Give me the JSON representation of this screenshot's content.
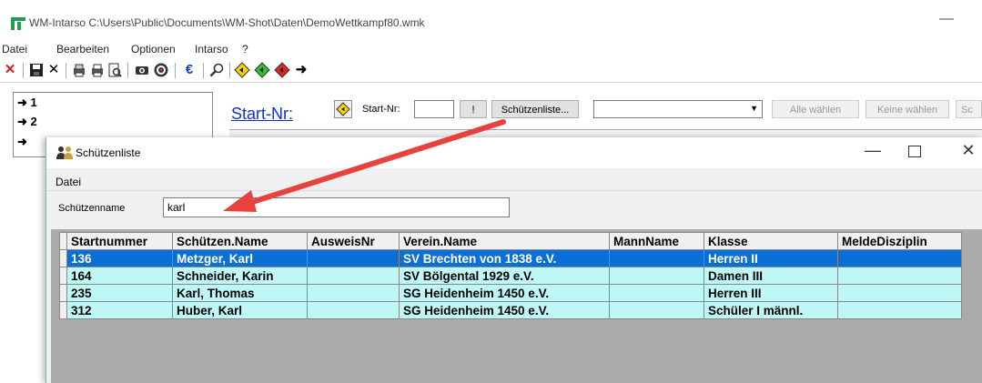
{
  "window": {
    "title": "WM-Intarso C:\\Users\\Public\\Documents\\WM-Shot\\Daten\\DemoWettkampf80.wmk",
    "minimize": "—"
  },
  "menu": [
    "Datei",
    "Bearbeiten",
    "Optionen",
    "Intarso",
    "?"
  ],
  "toolbar": {
    "icons": [
      "close-icon",
      "save-icon",
      "delete-icon",
      "print-setup-icon",
      "print-icon",
      "print-preview-icon",
      "camera-icon",
      "target-icon",
      "euro-icon",
      "search-icon",
      "yellow-diamond-icon",
      "green-diamond-icon",
      "red-diamond-icon",
      "arrow-right-icon"
    ],
    "close": "✕",
    "delete": "✕",
    "euro": "€",
    "arrow": "➜"
  },
  "tree": {
    "items": [
      "1",
      "2"
    ],
    "arrow": "➜"
  },
  "main": {
    "startnr_link": "Start-Nr:",
    "startnr_label": "Start-Nr:",
    "startnr_value": "",
    "excl_button": "!",
    "schuetzenliste_button": "Schützenliste...",
    "combo_value": "",
    "alle_waehlen": "Alle wählen",
    "keine_waehlen": "Keine wählen",
    "cut_button": "Sc"
  },
  "dialog": {
    "title": "Schützenliste",
    "menu": "Datei",
    "name_label": "Schützenname",
    "name_value": "karl",
    "minimize": "—",
    "close": "✕",
    "columns": [
      "Startnummer",
      "Schützen.Name",
      "AusweisNr",
      "Verein.Name",
      "MannName",
      "Klasse",
      "MeldeDisziplin"
    ],
    "rows": [
      {
        "startnummer": "136",
        "name": "Metzger, Karl",
        "ausweis": "",
        "verein": "SV Brechten von 1838 e.V.",
        "mann": "",
        "klasse": "Herren II",
        "melde": "",
        "selected": true
      },
      {
        "startnummer": "164",
        "name": "Schneider, Karin",
        "ausweis": "",
        "verein": "SV Bölgental 1929 e.V.",
        "mann": "",
        "klasse": "Damen III",
        "melde": ""
      },
      {
        "startnummer": "235",
        "name": "Karl, Thomas",
        "ausweis": "",
        "verein": "SG Heidenheim 1450 e.V.",
        "mann": "",
        "klasse": "Herren III",
        "melde": ""
      },
      {
        "startnummer": "312",
        "name": "Huber, Karl",
        "ausweis": "",
        "verein": "SG Heidenheim 1450 e.V.",
        "mann": "",
        "klasse": "Schüler I männl.",
        "melde": ""
      }
    ]
  },
  "colors": {
    "selected_row": "#0a6fd6",
    "row_bg": "#bff6f6",
    "arrow": "#e8423f",
    "link": "#1230c8"
  }
}
